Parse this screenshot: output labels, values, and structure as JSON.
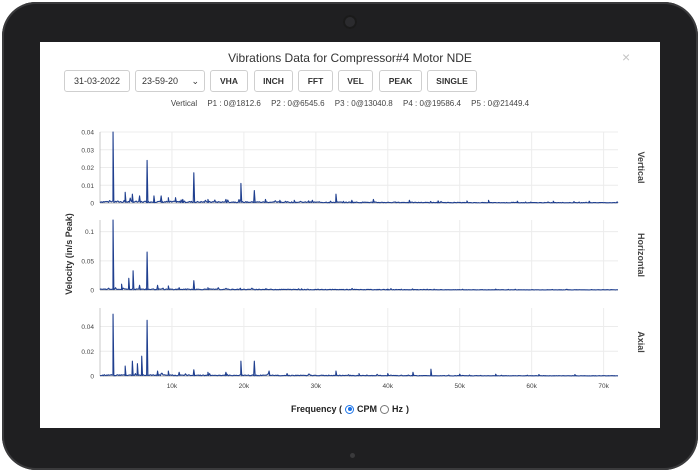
{
  "modal": {
    "title": "Vibrations Data for Compressor#4 Motor NDE",
    "close_glyph": "×"
  },
  "toolbar": {
    "date_value": "31-03-2022",
    "time_value": "23-59-20",
    "buttons": [
      "VHA",
      "INCH",
      "FFT",
      "VEL",
      "PEAK",
      "SINGLE"
    ]
  },
  "peak_info": {
    "label": "Vertical",
    "items": [
      "P1 : 0@1812.6",
      "P2 : 0@6545.6",
      "P3 : 0@13040.8",
      "P4 : 0@19586.4",
      "P5 : 0@21449.4"
    ]
  },
  "frequency_selector": {
    "label": "Frequency (",
    "suffix": ")",
    "options": [
      {
        "label": "CPM",
        "checked": true
      },
      {
        "label": "Hz",
        "checked": false
      }
    ]
  },
  "chart_data": {
    "type": "line",
    "ylabel": "Velocity (in/s Peak)",
    "xlim": [
      0,
      72000
    ],
    "x_ticks": [
      10000,
      20000,
      30000,
      40000,
      50000,
      60000,
      70000
    ],
    "x_tick_labels": [
      "10k",
      "20k",
      "30k",
      "40k",
      "50k",
      "60k",
      "70k"
    ],
    "line_color": "#1f3f8f",
    "grid": true,
    "panels": [
      {
        "name": "Vertical",
        "ylim": [
          0,
          0.04
        ],
        "y_ticks": [
          0,
          0.01,
          0.02,
          0.03,
          0.04
        ],
        "y_tick_labels": [
          "0",
          "0.01",
          "0.02",
          "0.03",
          "0.04"
        ],
        "baseline": 0.0008,
        "peaks": [
          [
            1812.6,
            0.04
          ],
          [
            3500,
            0.006
          ],
          [
            4500,
            0.005
          ],
          [
            5500,
            0.004
          ],
          [
            6545.6,
            0.024
          ],
          [
            7500,
            0.004
          ],
          [
            8500,
            0.004
          ],
          [
            9500,
            0.003
          ],
          [
            10500,
            0.003
          ],
          [
            11500,
            0.002
          ],
          [
            13040.8,
            0.017
          ],
          [
            15000,
            0.002
          ],
          [
            17500,
            0.002
          ],
          [
            19586.4,
            0.011
          ],
          [
            21449.4,
            0.007
          ],
          [
            23000,
            0.002
          ],
          [
            25000,
            0.0015
          ],
          [
            27000,
            0.0015
          ],
          [
            29000,
            0.0012
          ],
          [
            32800,
            0.005
          ],
          [
            35000,
            0.0015
          ],
          [
            38000,
            0.002
          ],
          [
            43000,
            0.0015
          ],
          [
            47000,
            0.0012
          ],
          [
            51000,
            0.0012
          ],
          [
            54000,
            0.0015
          ],
          [
            58000,
            0.001
          ],
          [
            63000,
            0.001
          ],
          [
            68000,
            0.001
          ]
        ]
      },
      {
        "name": "Horizontal",
        "ylim": [
          0,
          0.12
        ],
        "y_ticks": [
          0,
          0.05,
          0.1
        ],
        "y_tick_labels": [
          "0",
          "0.05",
          "0.1"
        ],
        "baseline": 0.0015,
        "peaks": [
          [
            1812.6,
            0.12
          ],
          [
            3000,
            0.01
          ],
          [
            4000,
            0.02
          ],
          [
            4600,
            0.033
          ],
          [
            5500,
            0.008
          ],
          [
            6545.6,
            0.065
          ],
          [
            8000,
            0.008
          ],
          [
            9500,
            0.007
          ],
          [
            11000,
            0.004
          ],
          [
            13040.8,
            0.016
          ],
          [
            15000,
            0.004
          ],
          [
            19500,
            0.003
          ],
          [
            23000,
            0.002
          ],
          [
            28000,
            0.002
          ],
          [
            40000,
            0.0015
          ],
          [
            55000,
            0.0015
          ]
        ]
      },
      {
        "name": "Axial",
        "ylim": [
          0,
          0.055
        ],
        "y_ticks": [
          0,
          0.02,
          0.04
        ],
        "y_tick_labels": [
          "0",
          "0.02",
          "0.04"
        ],
        "baseline": 0.0008,
        "peaks": [
          [
            1812.6,
            0.05
          ],
          [
            3500,
            0.008
          ],
          [
            4500,
            0.012
          ],
          [
            5200,
            0.01
          ],
          [
            5800,
            0.016
          ],
          [
            6545.6,
            0.045
          ],
          [
            8000,
            0.004
          ],
          [
            9500,
            0.004
          ],
          [
            11000,
            0.003
          ],
          [
            13040.8,
            0.005
          ],
          [
            15000,
            0.003
          ],
          [
            17500,
            0.003
          ],
          [
            19586.4,
            0.012
          ],
          [
            21449.4,
            0.012
          ],
          [
            23500,
            0.004
          ],
          [
            26000,
            0.002
          ],
          [
            32800,
            0.004
          ],
          [
            36000,
            0.002
          ],
          [
            40000,
            0.002
          ],
          [
            43500,
            0.003
          ],
          [
            46000,
            0.0055
          ],
          [
            50000,
            0.0015
          ],
          [
            55000,
            0.0015
          ],
          [
            61000,
            0.0012
          ],
          [
            66000,
            0.0012
          ]
        ]
      }
    ]
  }
}
